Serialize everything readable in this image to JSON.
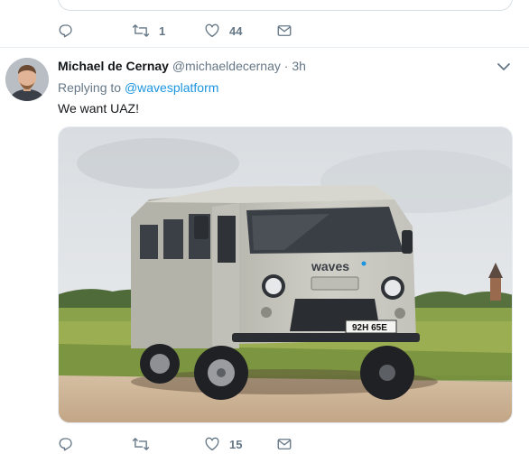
{
  "previous_tweet": {
    "actions": {
      "reply_count": "",
      "retweet_count": "1",
      "like_count": "44"
    }
  },
  "tweet": {
    "author_name": "Michael de Cernay",
    "author_handle": "@michaeldecernay",
    "separator": "·",
    "time": "3h",
    "replying_prefix": "Replying to",
    "replying_to": "@wavesplatform",
    "text": "We want UAZ!",
    "media": {
      "logo_text": "waves",
      "plate_text": "92H 65E",
      "colors": {
        "van": "#c9c9c1",
        "sky": "#e4e7ea",
        "field": "#8aa24a",
        "road": "#cfb79a"
      }
    },
    "actions": {
      "reply_count": "",
      "retweet_count": "",
      "like_count": "15"
    }
  },
  "icons": [
    "reply-icon",
    "retweet-icon",
    "like-icon",
    "dm-icon",
    "chevron-down-icon"
  ],
  "colors": {
    "secondary_text": "#657786",
    "link": "#1b95e0",
    "divider": "#e6ecf0"
  }
}
